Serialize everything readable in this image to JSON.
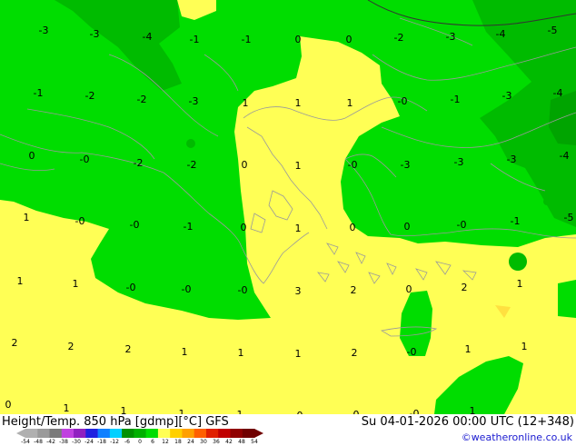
{
  "map": {
    "colors": {
      "yellow": "#ffff55",
      "green": "#00dd00",
      "dark_green": "#00bb00",
      "pale_orange": "#ffe040",
      "coast": "#9a9a9a",
      "contour": "#333333"
    },
    "temperature_labels": [
      "-3",
      "-3",
      "-4",
      "-1",
      "-1",
      "0",
      "0",
      "-2",
      "-3",
      "-4",
      "-5",
      "-1",
      "-2",
      "-2",
      "-3",
      "1",
      "1",
      "1",
      "-0",
      "-1",
      "-3",
      "-4",
      "0",
      "-0",
      "-2",
      "-2",
      "0",
      "1",
      "-0",
      "-3",
      "-3",
      "-3",
      "-4",
      "1",
      "-0",
      "-0",
      "-1",
      "0",
      "1",
      "0",
      "0",
      "-0",
      "-1",
      "-5",
      "1",
      "1",
      "-0",
      "-0",
      "-0",
      "3",
      "2",
      "0",
      "2",
      "1",
      "2",
      "2",
      "2",
      "1",
      "1",
      "1",
      "2",
      "-0",
      "1",
      "1",
      "0",
      "1",
      "1",
      "1",
      "1",
      "-0",
      "0",
      "-0",
      "1"
    ]
  },
  "footer": {
    "title": "Height/Temp. 850 hPa [gdmp][°C] GFS",
    "datetime": "Su 04-01-2026 00:00 UTC (12+348)",
    "copyright": "©weatheronline.co.uk"
  },
  "colorbar": {
    "ticks": [
      "-54",
      "-48",
      "-42",
      "-38",
      "-30",
      "-24",
      "-18",
      "-12",
      "-6",
      "0",
      "6",
      "12",
      "18",
      "24",
      "30",
      "36",
      "42",
      "48",
      "54"
    ],
    "colors": [
      "#b0b0b0",
      "#9a9a9a",
      "#7a7a7a",
      "#c040e0",
      "#9020c0",
      "#2020e0",
      "#1080ff",
      "#00d0ff",
      "#009000",
      "#00b000",
      "#00dd00",
      "#ffff55",
      "#ffd000",
      "#ffa000",
      "#ff6000",
      "#e02000",
      "#c00000",
      "#900000",
      "#700000"
    ]
  }
}
